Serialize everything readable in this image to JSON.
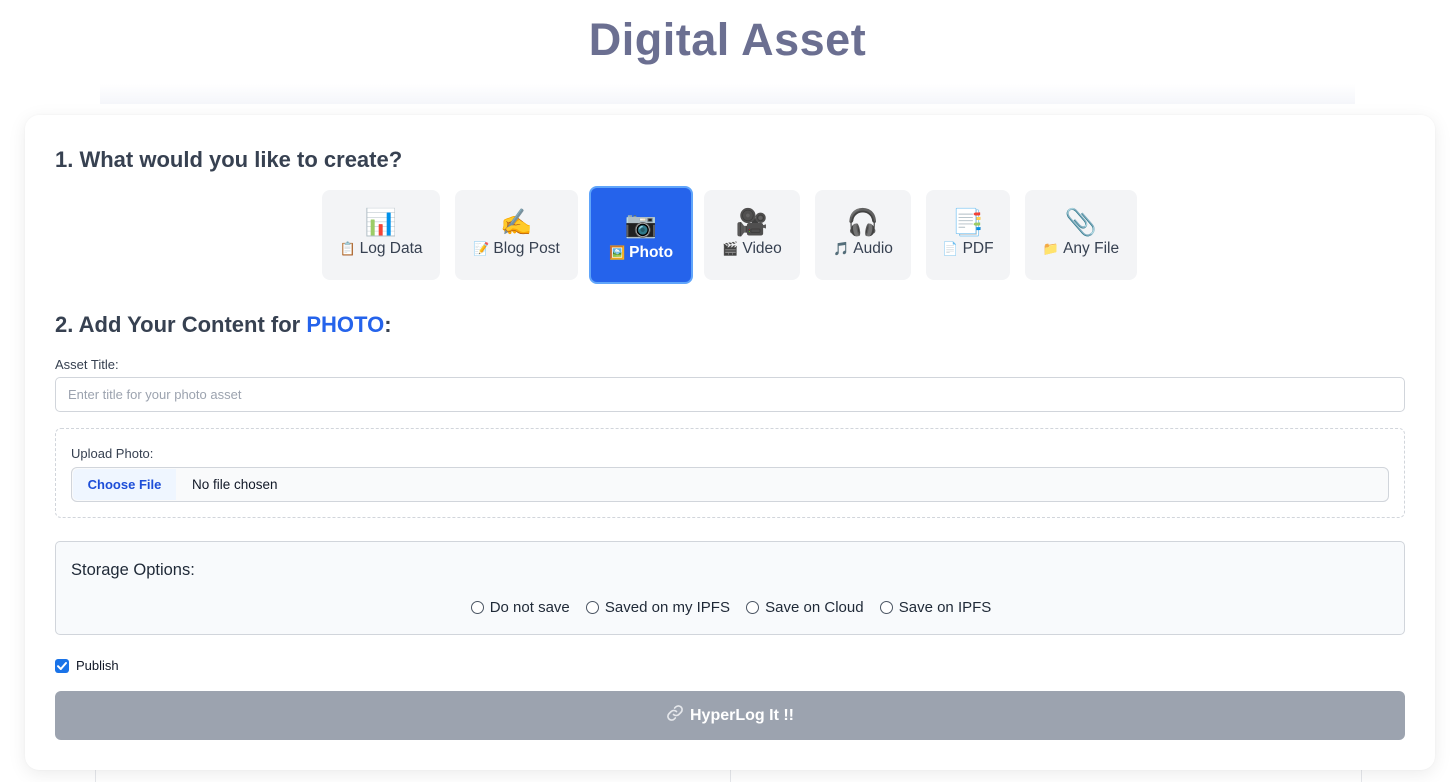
{
  "header": {
    "title": "Digital Asset"
  },
  "step1": {
    "heading": "1. What would you like to create?",
    "types": [
      {
        "name": "log-data",
        "big_icon": "📊",
        "small_icon": "📋",
        "label": "Log Data",
        "active": false
      },
      {
        "name": "blog-post",
        "big_icon": "✍️",
        "small_icon": "📝",
        "label": "Blog Post",
        "active": false
      },
      {
        "name": "photo",
        "big_icon": "📷",
        "small_icon": "🖼️",
        "label": "Photo",
        "active": true
      },
      {
        "name": "video",
        "big_icon": "🎥",
        "small_icon": "🎬",
        "label": "Video",
        "active": false
      },
      {
        "name": "audio",
        "big_icon": "🎧",
        "small_icon": "🎵",
        "label": "Audio",
        "active": false
      },
      {
        "name": "pdf",
        "big_icon": "📑",
        "small_icon": "📄",
        "label": "PDF",
        "active": false
      },
      {
        "name": "any-file",
        "big_icon": "📎",
        "small_icon": "📁",
        "label": "Any File",
        "active": false
      }
    ]
  },
  "step2": {
    "heading_prefix": "2. Add Your Content for ",
    "heading_type": "PHOTO",
    "heading_suffix": ":",
    "title_label": "Asset Title:",
    "title_placeholder": "Enter title for your photo asset",
    "title_value": "",
    "upload_label": "Upload Photo:",
    "choose_button": "Choose File",
    "file_status": "No file chosen"
  },
  "storage": {
    "title": "Storage Options:",
    "options": [
      "Do not save",
      "Saved on my IPFS",
      "Save on Cloud",
      "Save on IPFS"
    ],
    "selected": null
  },
  "publish": {
    "label": "Publish",
    "checked": true
  },
  "submit": {
    "label": "HyperLog It !!",
    "icon": "link-icon"
  },
  "colors": {
    "title": "#6b6f91",
    "accent": "#2563eb",
    "submit_disabled": "#9ca3af",
    "checkbox": "#1a73e8"
  }
}
